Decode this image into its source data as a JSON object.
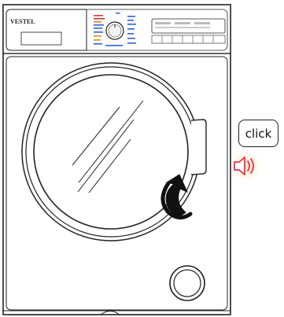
{
  "brand": "VESTEL",
  "hint": {
    "label": "click"
  },
  "colors": {
    "outline": "#222222",
    "speaker_red": "#e8334a",
    "speaker_glow": "#ffcf9a",
    "program_red": "#d43a2f",
    "program_blue": "#2f5fd4",
    "program_orange": "#e08a1a"
  },
  "icons": {
    "rotate_arrow": "curved-arrow-icon",
    "speaker": "speaker-sound-icon"
  }
}
